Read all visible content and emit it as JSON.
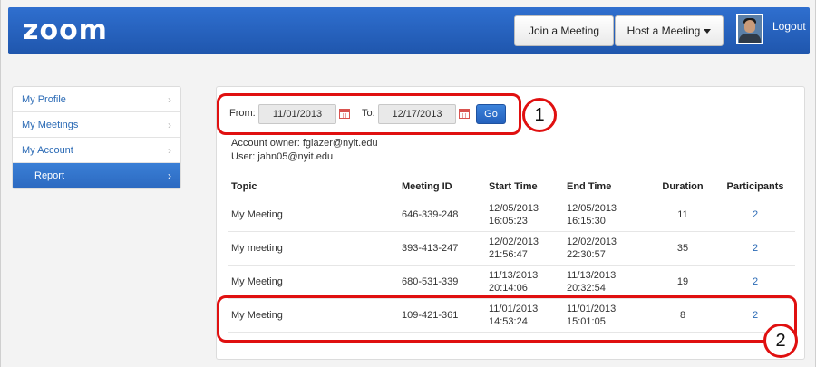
{
  "header": {
    "logo": "zoom",
    "join_label": "Join a Meeting",
    "host_label": "Host a Meeting",
    "logout_label": "Logout"
  },
  "sidebar": {
    "items": [
      {
        "label": "My Profile"
      },
      {
        "label": "My Meetings"
      },
      {
        "label": "My Account"
      },
      {
        "label": "Report"
      }
    ]
  },
  "filter": {
    "from_label": "From:",
    "from_value": "11/01/2013",
    "to_label": "To:",
    "to_value": "12/17/2013",
    "go_label": "Go"
  },
  "account": {
    "owner": "Account owner: fglazer@nyit.edu",
    "user": "User: jahn05@nyit.edu"
  },
  "table": {
    "headers": [
      "Topic",
      "Meeting ID",
      "Start Time",
      "End Time",
      "Duration",
      "Participants"
    ],
    "rows": [
      {
        "topic": "My Meeting",
        "meeting_id": "646-339-248",
        "start_date": "12/05/2013",
        "start_time": "16:05:23",
        "end_date": "12/05/2013",
        "end_time": "16:15:30",
        "duration": "11",
        "participants": "2"
      },
      {
        "topic": "My meeting",
        "meeting_id": "393-413-247",
        "start_date": "12/02/2013",
        "start_time": "21:56:47",
        "end_date": "12/02/2013",
        "end_time": "22:30:57",
        "duration": "35",
        "participants": "2"
      },
      {
        "topic": "My Meeting",
        "meeting_id": "680-531-339",
        "start_date": "11/13/2013",
        "start_time": "20:14:06",
        "end_date": "11/13/2013",
        "end_time": "20:32:54",
        "duration": "19",
        "participants": "2"
      },
      {
        "topic": "My Meeting",
        "meeting_id": "109-421-361",
        "start_date": "11/01/2013",
        "start_time": "14:53:24",
        "end_date": "11/01/2013",
        "end_time": "15:01:05",
        "duration": "8",
        "participants": "2"
      }
    ]
  },
  "annotations": {
    "one": "1",
    "two": "2"
  },
  "colors": {
    "header_blue": "#2560bd",
    "link_blue": "#2a6ab5",
    "annotation_red": "#e01010"
  }
}
